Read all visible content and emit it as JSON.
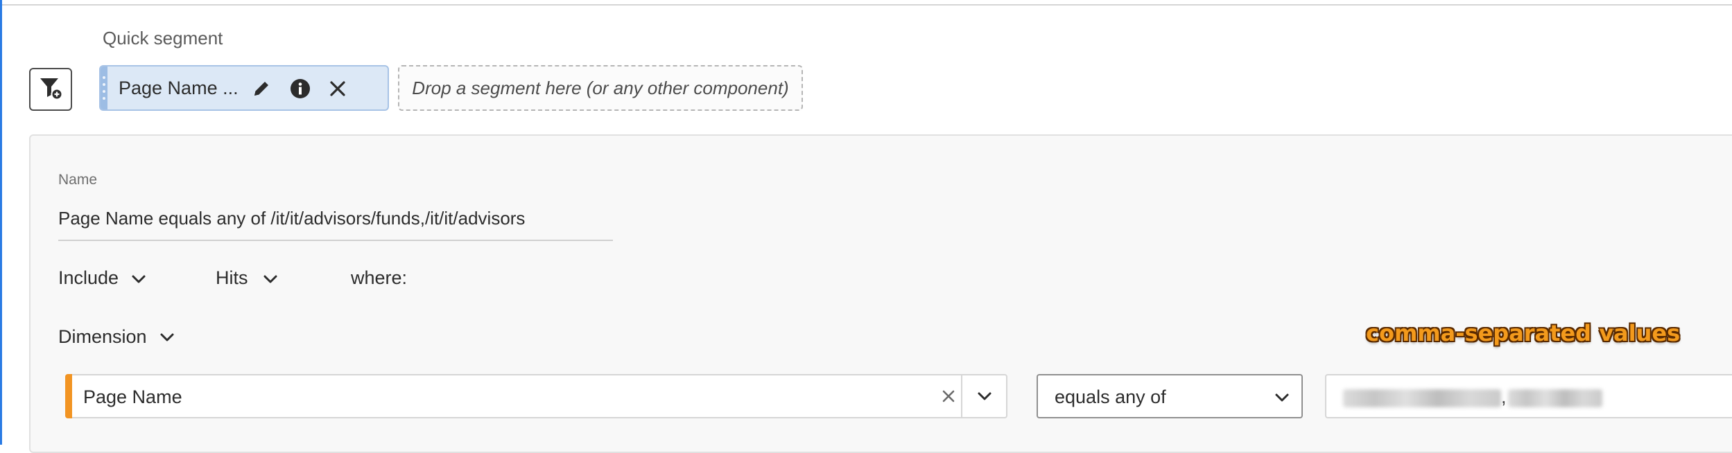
{
  "quick_segment": {
    "label": "Quick segment",
    "chip_label": "Page Name ...",
    "drop_zone_text": "Drop a segment here (or any other component)"
  },
  "editor": {
    "name_label": "Name",
    "name_value": "Page Name equals any of /it/it/advisors/funds,/it/it/advisors",
    "include_label": "Include",
    "hits_label": "Hits",
    "where_label": "where:",
    "dimension_label": "Dimension",
    "dimension_value": "Page Name",
    "operator_value": "equals any of",
    "values_separator": ","
  },
  "annotation": "comma-separated values",
  "colors": {
    "accent_orange": "#f29423",
    "chip_background": "#dce8f6",
    "left_bar": "#2a7be4"
  },
  "icons": [
    "filter-add-icon",
    "pencil-icon",
    "info-icon",
    "close-icon",
    "chevron-down-icon",
    "clear-icon"
  ]
}
